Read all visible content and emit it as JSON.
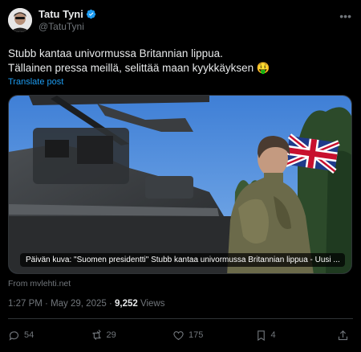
{
  "author": {
    "name": "Tatu Tyni",
    "handle": "@TatuTyni",
    "verified_color": "#1d9bf0",
    "avatar_icon": "avatar-photo"
  },
  "menu_icon": "more-icon",
  "post": {
    "line1": "Stubb kantaa univormussa Britannian lippua.",
    "line2": "Tällainen pressa meillä, selittää maan kyykkäyksen 🤑",
    "translate_label": "Translate post"
  },
  "media": {
    "caption": "Päivän kuva: \"Suomen presidentti\" Stubb kantaa univormussa Britannian lippua - Uusi ..."
  },
  "link_source": "From mvlehti.net",
  "meta": {
    "time": "1:27 PM",
    "separator": "·",
    "date": "May 29, 2025",
    "views_count": "9,252",
    "views_label": "Views"
  },
  "actions": {
    "replies": "54",
    "reposts": "29",
    "likes": "175",
    "bookmarks": "4"
  },
  "colors": {
    "background": "#000000",
    "text": "#e7e9ea",
    "secondary": "#71767b",
    "link": "#1d9bf0",
    "divider": "#2f3336"
  }
}
